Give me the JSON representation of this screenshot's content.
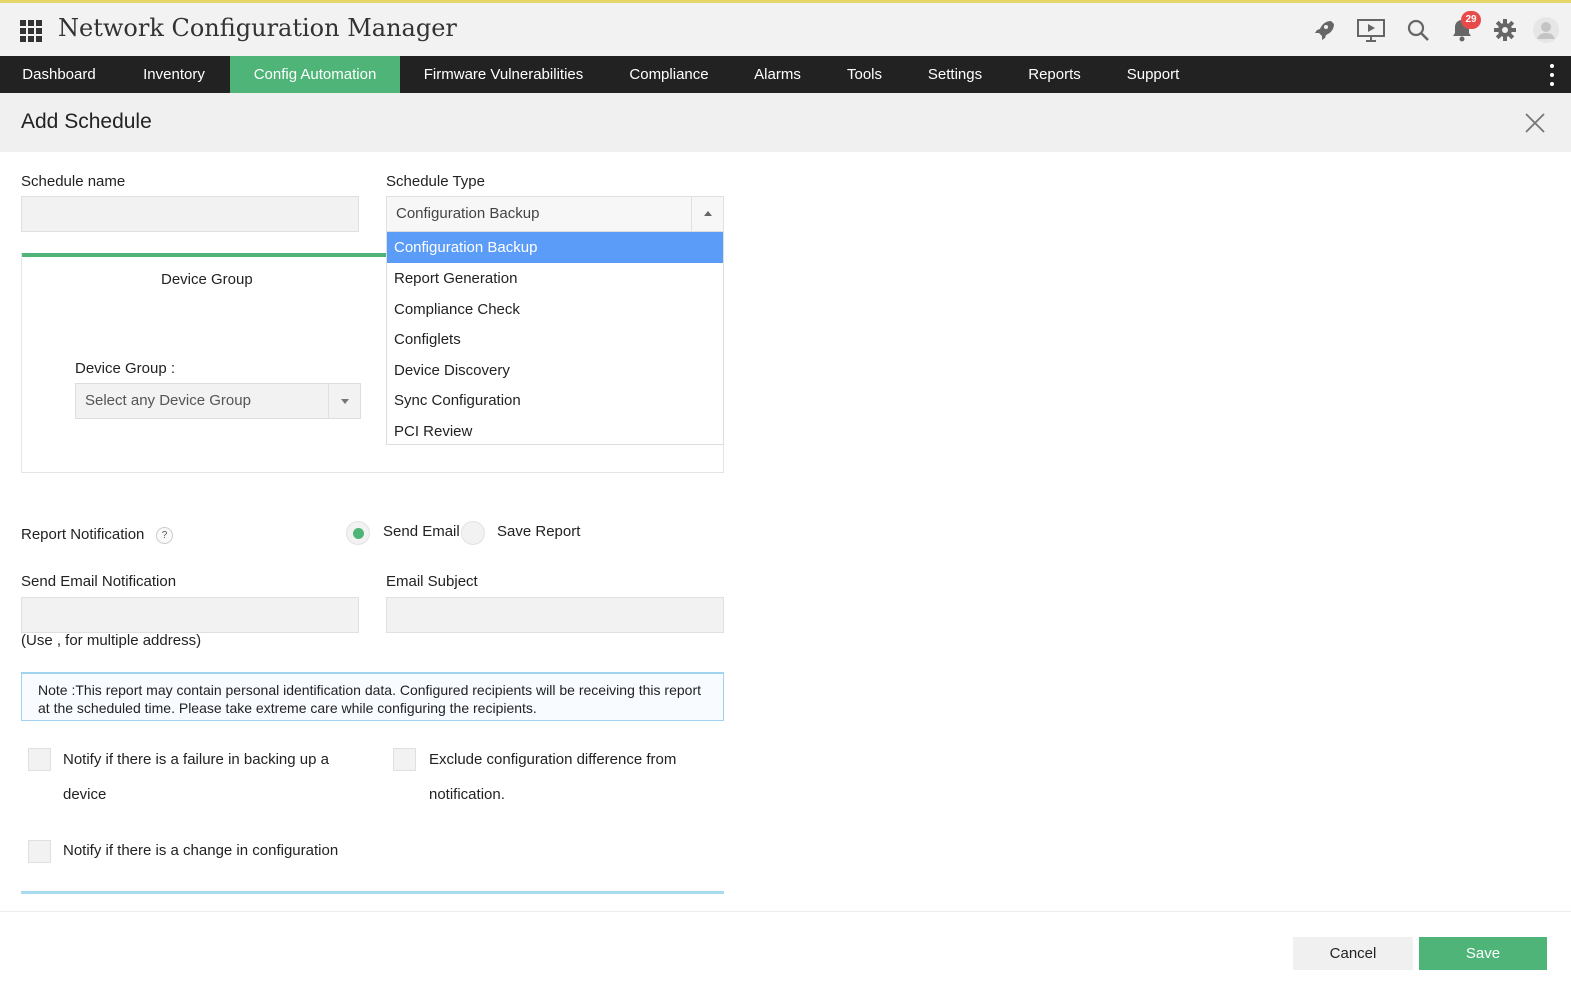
{
  "app": {
    "title": "Network Configuration Manager",
    "notification_count": "29"
  },
  "icons": [
    "apps-grid-icon",
    "rocket-icon",
    "presentation-icon",
    "search-icon",
    "bell-icon",
    "gear-icon",
    "user-avatar-icon",
    "close-icon",
    "help-icon",
    "kebab-menu-icon"
  ],
  "nav": {
    "items": [
      "Dashboard",
      "Inventory",
      "Config Automation",
      "Firmware Vulnerabilities",
      "Compliance",
      "Alarms",
      "Tools",
      "Settings",
      "Reports",
      "Support"
    ],
    "active": "Config Automation"
  },
  "page": {
    "title": "Add Schedule"
  },
  "form": {
    "schedule_name_label": "Schedule name",
    "schedule_name_value": "",
    "schedule_type_label": "Schedule Type",
    "schedule_type_value": "Configuration Backup",
    "schedule_type_options": [
      "Configuration Backup",
      "Report Generation",
      "Compliance Check",
      "Configlets",
      "Device Discovery",
      "Sync Configuration",
      "PCI Review"
    ],
    "device_group_tab": "Device Group",
    "device_group_label": "Device Group :",
    "device_group_placeholder": "Select any Device Group",
    "report_notification_label": "Report Notification",
    "help_mark": "?",
    "radio_send_email": "Send Email",
    "radio_save_report": "Save Report",
    "radio_selected": "Send Email",
    "send_email_label": "Send Email Notification",
    "send_email_value": "",
    "email_hint": "(Use , for multiple address)",
    "email_subject_label": "Email Subject",
    "email_subject_value": "",
    "note": "Note :This report may contain personal identification data. Configured recipients will be receiving this report at the scheduled time. Please take extreme care while configuring the recipients.",
    "check_failure": "Notify if there is a failure in backing up a device",
    "check_failure_line1": "Notify if there is a failure in backing up a",
    "check_failure_line2": "device",
    "check_exclude_line1": "Exclude configuration difference from",
    "check_exclude_line2": "notification.",
    "check_change": "Notify if there is a change in configuration"
  },
  "footer": {
    "cancel": "Cancel",
    "save": "Save"
  },
  "colors": {
    "accent": "#4fb477",
    "nav_bg": "#222222",
    "dropdown_selected": "#5b9cf8",
    "badge": "#e84a4a"
  }
}
